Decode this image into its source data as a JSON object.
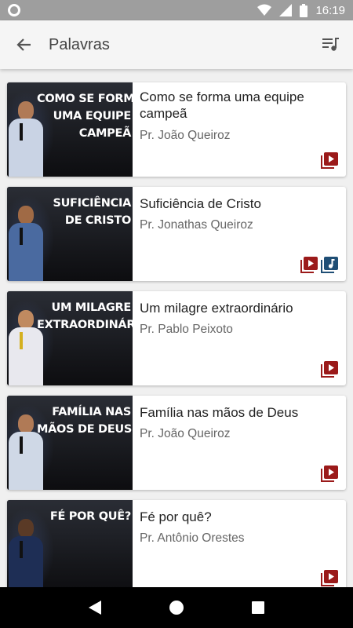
{
  "status_bar": {
    "time": "16:19",
    "icons": [
      "circle-icon",
      "wifi-icon",
      "signal-icon",
      "battery-icon"
    ]
  },
  "app_bar": {
    "title": "Palavras",
    "icons": [
      "back-arrow-icon",
      "playlist-icon"
    ]
  },
  "colors": {
    "video": "#9b1a1a",
    "audio": "#1f4e75",
    "title": "#222222",
    "subtitle": "#666666"
  },
  "items": [
    {
      "caption_lines": [
        "COMO SE FORMA",
        "UMA EQUIPE",
        "CAMPEÃ"
      ],
      "title": "Como se forma uma equipe campeã",
      "speaker": "Pr. João Queiroz",
      "media": [
        "video-icon"
      ]
    },
    {
      "caption_lines": [
        "SUFICIÊNCIA",
        "DE CRISTO"
      ],
      "title": "Suficiência de Cristo",
      "speaker": "Pr. Jonathas Queiroz",
      "media": [
        "video-icon",
        "audio-icon"
      ]
    },
    {
      "caption_lines": [
        "UM MILAGRE",
        "EXTRAORDINÁRIO"
      ],
      "title": "Um milagre extraordinário",
      "speaker": "Pr. Pablo Peixoto",
      "media": [
        "video-icon"
      ]
    },
    {
      "caption_lines": [
        "FAMÍLIA NAS",
        "MÃOS DE DEUS"
      ],
      "title": "Família nas mãos de Deus",
      "speaker": "Pr. João Queiroz",
      "media": [
        "video-icon"
      ]
    },
    {
      "caption_lines": [
        "FÉ POR QUÊ?"
      ],
      "title": "Fé por quê?",
      "speaker": "Pr. Antônio Orestes",
      "media": [
        "video-icon"
      ]
    }
  ],
  "nav_bar": {
    "icons": [
      "back-triangle-icon",
      "home-circle-icon",
      "recents-square-icon"
    ]
  }
}
